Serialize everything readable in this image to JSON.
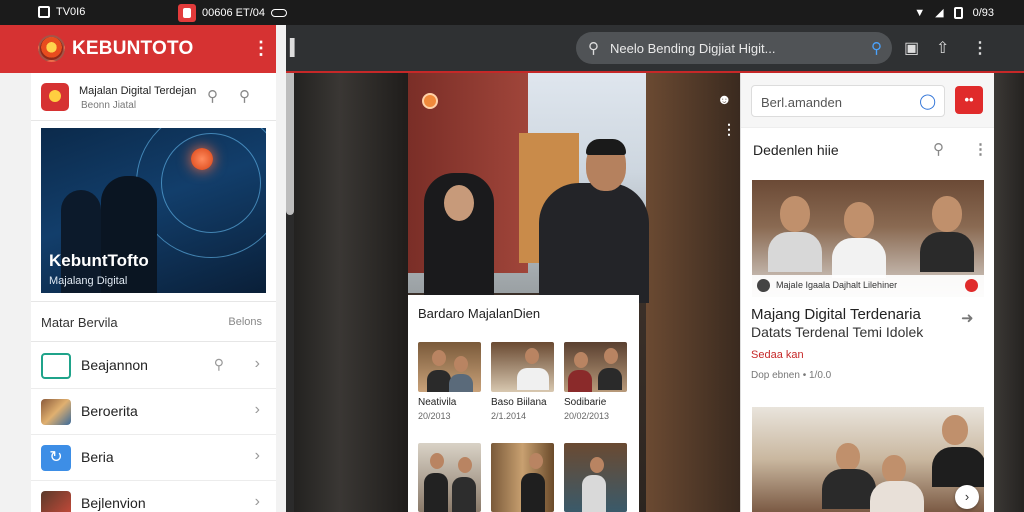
{
  "status_bar": {
    "time": "TV0I6",
    "center_text": "00606 ET/04",
    "right_text": "0/93"
  },
  "browser": {
    "url_text": "Neelo Bending Digjiat Higit..."
  },
  "app": {
    "title": "KEBUNTOTO"
  },
  "left_card": {
    "title": "Majalan Digital Terdejan",
    "subtitle": "Beonn Jiatal",
    "hero_title": "KebuntTofto",
    "hero_subtitle": "Majalang Digital",
    "section_title": "Matar Bervila",
    "section_more": "Belons",
    "menu": [
      {
        "label": "Beajannon",
        "icon": "hair-icon"
      },
      {
        "label": "Beroerita",
        "icon": "group-photo-icon"
      },
      {
        "label": "Beria",
        "icon": "refresh-icon"
      },
      {
        "label": "Bejlenvion",
        "icon": "photo-icon"
      }
    ]
  },
  "center": {
    "grid_title": "Bardaro MajalanDien",
    "thumbs": [
      {
        "caption": "Neativila",
        "date": "20/2013"
      },
      {
        "caption": "Baso Biilana",
        "date": "2/1.2014"
      },
      {
        "caption": "Sodibarie",
        "date": "20/02/2013"
      }
    ]
  },
  "right": {
    "search_placeholder": "Berl.amanden",
    "red_button": "••",
    "header_title": "Dedenlen hiie",
    "photo_bar_text": "MajaIe Igaala Dajhalt Lilehiner",
    "article_title": "Majang Digital Terdenaria",
    "article_subtitle": "Datats Terdenal Temi Idolek",
    "article_tag": "Sedaa kan",
    "article_meta": "Dop ebnen  •  1/0.0"
  }
}
